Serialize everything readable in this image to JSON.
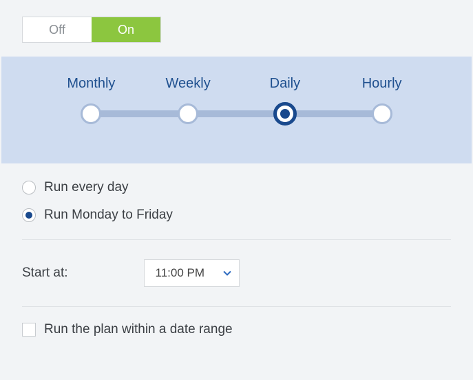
{
  "toggle": {
    "off_label": "Off",
    "on_label": "On",
    "state": "on"
  },
  "frequency": {
    "options": [
      "Monthly",
      "Weekly",
      "Daily",
      "Hourly"
    ],
    "selected_index": 2
  },
  "run_mode": {
    "options": {
      "every_day": "Run every day",
      "weekdays": "Run Monday to Friday"
    },
    "selected": "weekdays"
  },
  "start": {
    "label": "Start at:",
    "value": "11:00 PM"
  },
  "date_range": {
    "label": "Run the plan within a date range",
    "checked": false
  }
}
